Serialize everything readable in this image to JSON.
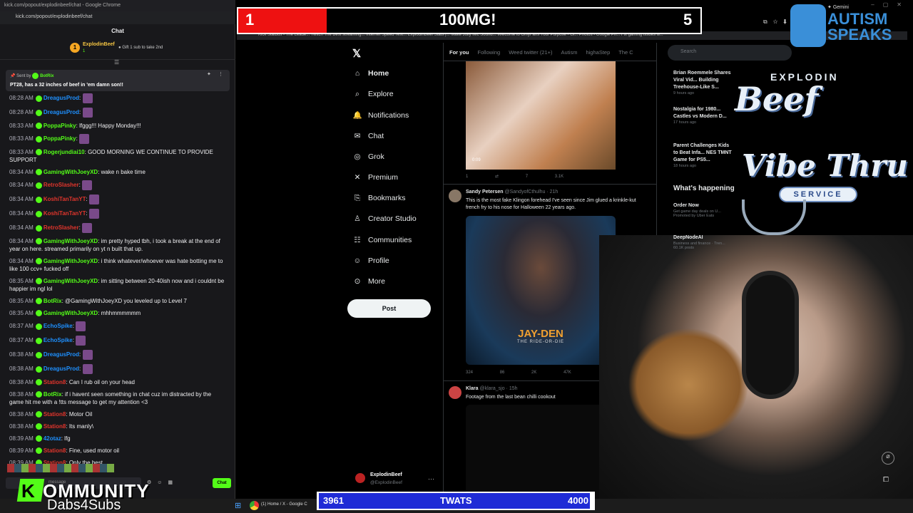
{
  "chat": {
    "window_title": "kick.com/popout/explodinbeef/chat - Google Chrome",
    "url": "kick.com/popout/explodinbeef/chat",
    "header": "Chat",
    "top_sub": {
      "badge": "1",
      "name": "ExplodinBeef",
      "count": "1",
      "gift_text": "Gift 1 sub to take 2nd"
    },
    "pinned": {
      "sent_by_label": "Sent by",
      "sender": "BotRix",
      "message": "PT28, has a 32 inches of beef in 'em damn son!!"
    },
    "messages": [
      {
        "time": "08:28 AM",
        "user": "DreagusProd",
        "color": "#1e90ff",
        "text": "",
        "emote": true
      },
      {
        "time": "08:28 AM",
        "user": "DreagusProd",
        "color": "#1e90ff",
        "text": "",
        "emote": true
      },
      {
        "time": "08:33 AM",
        "user": "PoppaPinky",
        "color": "#53fc18",
        "text": "lfggg!!! Happy Monday!!!",
        "emote": false
      },
      {
        "time": "08:33 AM",
        "user": "PoppaPinky",
        "color": "#53fc18",
        "text": "",
        "emote": true
      },
      {
        "time": "08:33 AM",
        "user": "Rogerjundiai10",
        "color": "#53fc18",
        "text": "GOOD MORNING WE CONTINUE TO PROVIDE SUPPORT",
        "emote": false
      },
      {
        "time": "08:34 AM",
        "user": "GamingWithJoeyXD",
        "color": "#53fc18",
        "text": "wake n bake time",
        "emote": false
      },
      {
        "time": "08:34 AM",
        "user": "RetroSlasher",
        "color": "#e0352c",
        "text": "",
        "emote": true
      },
      {
        "time": "08:34 AM",
        "user": "KoshiTanTanYT",
        "color": "#e0352c",
        "text": "",
        "emote": true
      },
      {
        "time": "08:34 AM",
        "user": "KoshiTanTanYT",
        "color": "#e0352c",
        "text": "",
        "emote": true
      },
      {
        "time": "08:34 AM",
        "user": "RetroSlasher",
        "color": "#e0352c",
        "text": "",
        "emote": true
      },
      {
        "time": "08:34 AM",
        "user": "GamingWithJoeyXD",
        "color": "#53fc18",
        "text": "im pretty hyped tbh, i took a break at the end of year on here. streamed primarily on yt n built that up.",
        "emote": false
      },
      {
        "time": "08:34 AM",
        "user": "GamingWithJoeyXD",
        "color": "#53fc18",
        "text": "i think whatever/whoever was hate botting me to like 100 ccv+ fucked off",
        "emote": false
      },
      {
        "time": "08:35 AM",
        "user": "GamingWithJoeyXD",
        "color": "#53fc18",
        "text": "im sitting between 20-40ish now and i couldnt be happier im ngl lol",
        "emote": false
      },
      {
        "time": "08:35 AM",
        "user": "BotRix",
        "color": "#53fc18",
        "text": "@GamingWithJoeyXD you leveled up to Level 7",
        "emote": false
      },
      {
        "time": "08:35 AM",
        "user": "GamingWithJoeyXD",
        "color": "#53fc18",
        "text": "mhhmmmmmm",
        "emote": false
      },
      {
        "time": "08:37 AM",
        "user": "EchoSpike",
        "color": "#1e90ff",
        "text": "",
        "emote": true
      },
      {
        "time": "08:37 AM",
        "user": "EchoSpike",
        "color": "#1e90ff",
        "text": "",
        "emote": true
      },
      {
        "time": "08:38 AM",
        "user": "DreagusProd",
        "color": "#1e90ff",
        "text": "",
        "emote": true
      },
      {
        "time": "08:38 AM",
        "user": "DreagusProd",
        "color": "#1e90ff",
        "text": "",
        "emote": true
      },
      {
        "time": "08:38 AM",
        "user": "Station8",
        "color": "#e0352c",
        "text": "Can I rub oil on your head",
        "emote": false
      },
      {
        "time": "08:38 AM",
        "user": "BotRix",
        "color": "#53fc18",
        "text": "if i havent seen something in chat cuz im distracted by the game hit me with a !tts message to get my attention <3",
        "emote": false
      },
      {
        "time": "08:38 AM",
        "user": "Station8",
        "color": "#e0352c",
        "text": "Motor Oil",
        "emote": false
      },
      {
        "time": "08:38 AM",
        "user": "Station8",
        "color": "#e0352c",
        "text": "Its manly\\",
        "emote": false
      },
      {
        "time": "08:39 AM",
        "user": "42otaz",
        "color": "#1e90ff",
        "text": "lfg",
        "emote": false
      },
      {
        "time": "08:39 AM",
        "user": "Station8",
        "color": "#e0352c",
        "text": "Fine, used motor oil",
        "emote": false
      },
      {
        "time": "08:39 AM",
        "user": "Station8",
        "color": "#e0352c",
        "text": "Only the best",
        "emote": false
      }
    ],
    "input_placeholder": "message",
    "send_label": "Chat"
  },
  "goal": {
    "left": "1",
    "title": "100MG!",
    "right": "5",
    "progress": 0.2
  },
  "bookmarks": "Kick   Statbus - The Leade...   Twitch   The Best streaming...   Internet Speed Test...   ExplodinBeef Stats |...   Make Jolly Mic Sound...   Welcome to OnlyFans   Your Purpose - Gl...   Photos - Google Ph...   Fix gaming issues w...",
  "x": {
    "nav": [
      {
        "label": "Home",
        "icon": "home-icon"
      },
      {
        "label": "Explore",
        "icon": "search-icon"
      },
      {
        "label": "Notifications",
        "icon": "bell-icon"
      },
      {
        "label": "Chat",
        "icon": "mail-icon"
      },
      {
        "label": "Grok",
        "icon": "grok-icon"
      },
      {
        "label": "Premium",
        "icon": "x-icon"
      },
      {
        "label": "Bookmarks",
        "icon": "bookmark-icon"
      },
      {
        "label": "Creator Studio",
        "icon": "studio-icon"
      },
      {
        "label": "Communities",
        "icon": "people-icon"
      },
      {
        "label": "Profile",
        "icon": "person-icon"
      },
      {
        "label": "More",
        "icon": "more-icon"
      }
    ],
    "post_label": "Post",
    "profile": {
      "name": "ExplodinBeef",
      "handle": "@ExplodinBeef"
    },
    "tabs": [
      "For you",
      "Following",
      "Weed twitter (21+)",
      "Autism",
      "highaStep",
      "The C"
    ],
    "tweet1": {
      "duration": "0:09",
      "replies": "1",
      "retweets": "",
      "likes": "7",
      "views": "3.1K"
    },
    "tweet2": {
      "name": "Sandy Petersen",
      "handle": "@SandyofCthulhu",
      "age": "21h",
      "text": "This is the most fake Klingon forehead I've seen since Jim glued a krinkle-kut french fry to his nose for Halloween 22 years ago.",
      "media_title": "JAY-DEN",
      "media_subtitle": "THE RIDE-OR-DIE",
      "replies": "324",
      "retweets": "86",
      "likes": "2K",
      "views": "47K"
    },
    "tweet3": {
      "name": "Klara",
      "handle": "@klara_sjo",
      "age": "15h",
      "text": "Footage from the last bean chilli cookout"
    },
    "search_placeholder": "Search",
    "news": [
      {
        "title": "Brian Roemmele Shares Viral Vid... Building Treehouse-Like S...",
        "meta": "9 hours ago"
      },
      {
        "title": "Nostalgia for 1980... Castles vs Modern D...",
        "meta": "17 hours ago"
      },
      {
        "title": "Parent Challenges Kids to Beat Infa... NES TMNT Game for PS5...",
        "meta": "18 hours ago"
      }
    ],
    "happening": "What's happening",
    "trends": [
      {
        "title": "Order Now",
        "sub": "Get game day deals on U...",
        "meta": "Promoted by Uber Eats"
      },
      {
        "title": "DeepNodeAI",
        "sub": "",
        "meta": "Business and finance · Tren... 60.1K posts"
      }
    ]
  },
  "overlay": {
    "autism": "AUTISM SPEAKS",
    "beef_top": "EXPLODIN",
    "beef_word": "Beef",
    "vibe": "Vibe Thru",
    "service": "SERVICE",
    "kommunity": "OMMUNITY",
    "kommunity_k": "K",
    "dabs": "Dabs4Subs",
    "subgoal": {
      "left": "3961",
      "title": "TWATS",
      "right": "4000",
      "progress": 0.99
    }
  },
  "taskbar": {
    "task": "(1) Home / X - Google C"
  },
  "gemini": "Gemini",
  "colors": {
    "kick_green": "#53fc18",
    "goal_red": "#e11",
    "subgoal_blue": "#1f2bd6",
    "x_bg": "#000000"
  }
}
